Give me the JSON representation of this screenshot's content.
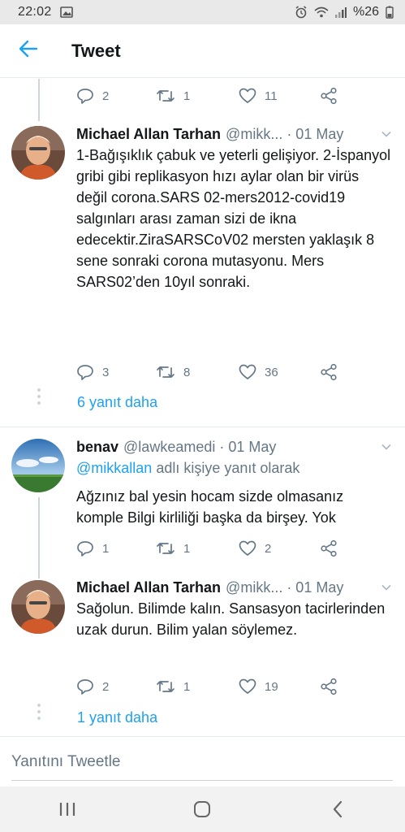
{
  "status_bar": {
    "time": "22:02",
    "battery": "%26"
  },
  "app_bar": {
    "title": "Tweet"
  },
  "top_actions": {
    "reply": "2",
    "retweet": "1",
    "like": "11"
  },
  "tweets": [
    {
      "name": "Michael Allan Tarhan",
      "handle": "@mikk... · 01 May",
      "text": "1-Bağışıklık çabuk ve yeterli gelişiyor. 2-İspanyol gribi gibi replikasyon hızı aylar olan bir virüs değil corona.SARS 02-mers2012-covid19 salgınları arası zaman sizi de ikna edecektir.ZiraSARSCoV02 mersten yaklaşık 8 sene sonraki corona mutasyonu. Mers SARS02’den 10yıl sonraki.",
      "reply": "3",
      "retweet": "8",
      "like": "36",
      "more": "6 yanıt daha"
    },
    {
      "name": "benav",
      "handle": "@lawkeamedi · 01 May",
      "reply_mention": "@mikkallan",
      "reply_suffix": "adlı kişiye yanıt olarak",
      "text": "Ağzınız bal yesin hocam sizde olmasanız komple Bilgi kirliliği başka da birşey. Yok",
      "reply": "1",
      "retweet": "1",
      "like": "2"
    },
    {
      "name": "Michael Allan Tarhan",
      "handle": "@mikk... · 01 May",
      "text": "Sağolun. Bilimde kalın. Sansasyon tacirlerinden uzak durun. Bilim yalan söylemez.",
      "reply": "2",
      "retweet": "1",
      "like": "19",
      "more": "1 yanıt daha"
    }
  ],
  "compose": {
    "placeholder": "Yanıtını Tweetle"
  },
  "colors": {
    "accent": "#1da1f2",
    "secondary": "#657786",
    "text": "#14171a"
  }
}
